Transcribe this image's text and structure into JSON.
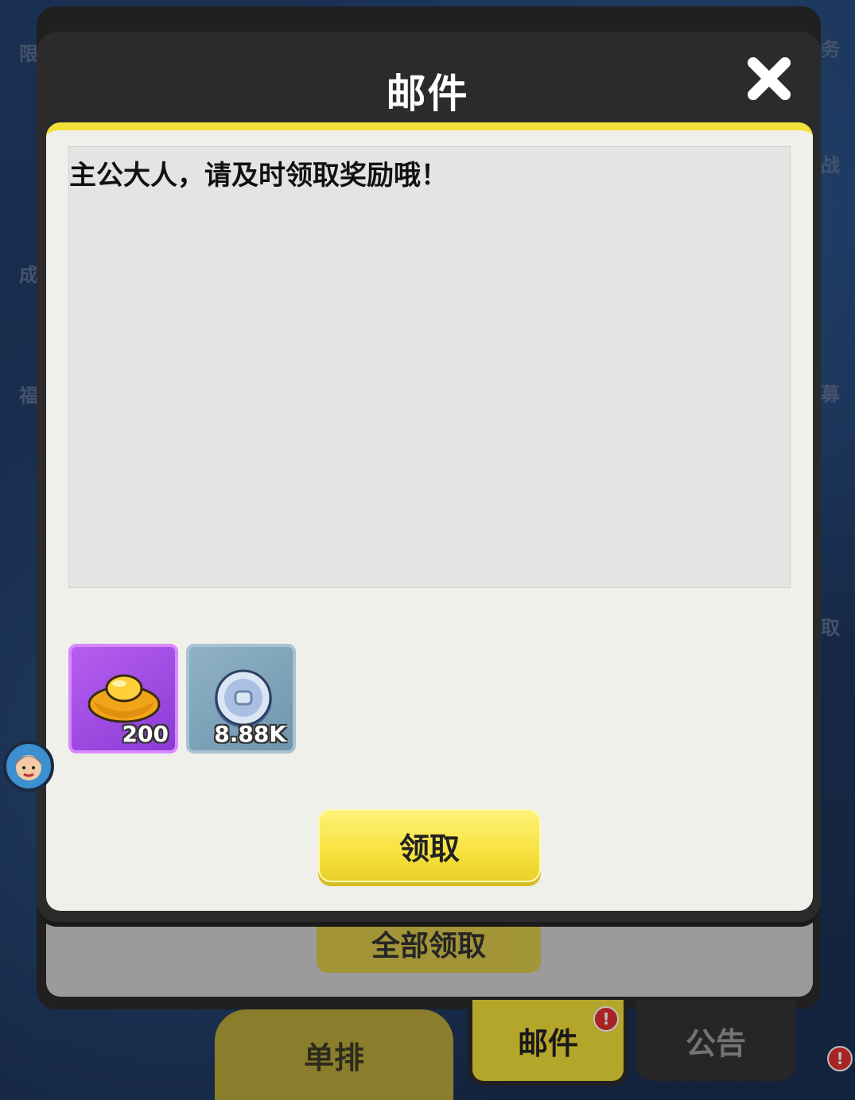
{
  "modal": {
    "title": "邮件",
    "message": "主公大人，请及时领取奖励哦！",
    "claim_label": "领取"
  },
  "rewards": [
    {
      "icon": "gold-ingot-icon",
      "quantity": "200"
    },
    {
      "icon": "silver-coin-icon",
      "quantity": "8.88K"
    }
  ],
  "background_panel": {
    "claim_all_label": "全部领取"
  },
  "tabs": [
    {
      "label": "单排"
    },
    {
      "label": "邮件",
      "badge": "!"
    },
    {
      "label": "公告"
    }
  ],
  "side_labels": {
    "left": [
      "限",
      "成",
      "福"
    ],
    "right": [
      "务",
      "战",
      "募",
      "取"
    ]
  },
  "colors": {
    "accent_yellow": "#f4e03a",
    "panel_dark": "#2b2b2b",
    "content_bg": "#f0f0ea",
    "gold_item_bg": "#a64fe6",
    "coin_item_bg": "#7fa4bb"
  }
}
